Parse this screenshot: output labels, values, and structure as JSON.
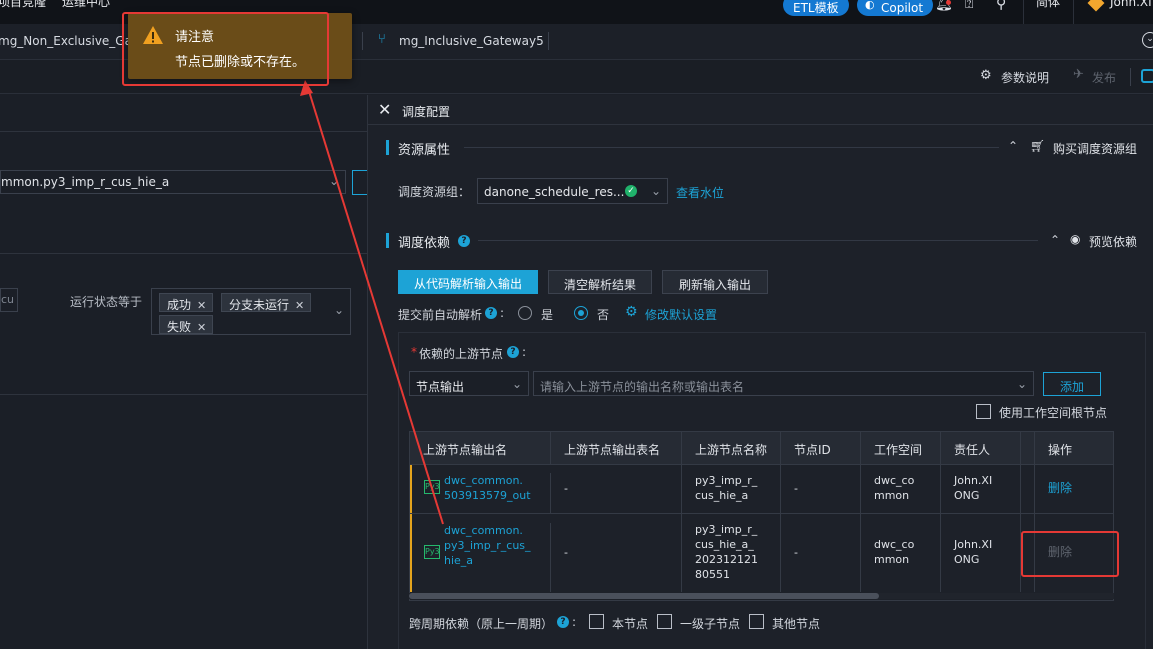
{
  "topbar": {
    "menu_items": [
      "项目竞隆",
      "运维中心"
    ],
    "etl_label": "ETL模板",
    "copilot_label": "Copilot",
    "lang_label": "简体",
    "user_name": "John.XI"
  },
  "tabs": [
    {
      "label": "mg_Non_Exclusive_Gateway"
    },
    {
      "label": "mg_Inclusive_Gateway5"
    }
  ],
  "toolbar": {
    "params_label": "参数说明",
    "publish_label": "发布"
  },
  "left_panel": {
    "node_select_value": "mmon.py3_imp_r_cus_hie_a",
    "cu_input_value": "cu",
    "status_label": "运行状态等于",
    "status_tags": [
      "成功",
      "分支未运行",
      "失败"
    ]
  },
  "right_panel": {
    "title": "调度配置",
    "resource": {
      "section_title": "资源属性",
      "buy_label": "购买调度资源组",
      "group_label": "调度资源组：",
      "group_value": "danone_schedule_res...",
      "water_link": "查看水位"
    },
    "dependency": {
      "section_title": "调度依赖",
      "preview_label": "预览依赖",
      "btn_parse": "从代码解析输入输出",
      "btn_clear": "清空解析结果",
      "btn_refresh": "刷新输入输出",
      "auto_parse_label": "提交前自动解析",
      "radio_yes": "是",
      "radio_no": "否",
      "modify_default": "修改默认设置",
      "upstream_label": "依赖的上游节点",
      "upstream_type": "节点输出",
      "upstream_placeholder": "请输入上游节点的输出名称或输出表名",
      "add_btn": "添加",
      "use_root_label": "使用工作空间根节点",
      "table": {
        "headers": [
          "上游节点输出名",
          "上游节点输出表名",
          "上游节点名称",
          "节点ID",
          "工作空间",
          "责任人",
          "",
          "操作"
        ],
        "rows": [
          {
            "output_name_1": "dwc_common.",
            "output_name_2": "503913579_out",
            "table_name": "-",
            "node_name_1": "py3_imp_r_",
            "node_name_2": "cus_hie_a",
            "node_id": "-",
            "workspace_1": "dwc_co",
            "workspace_2": "mmon",
            "owner_1": "John.XI",
            "owner_2": "ONG",
            "action": "删除"
          },
          {
            "output_name_1": "dwc_common.",
            "output_name_2": "py3_imp_r_cus_",
            "output_name_3": "hie_a",
            "table_name": "-",
            "node_name_1": "py3_imp_r_",
            "node_name_2": "cus_hie_a_",
            "node_name_3": "202312121",
            "node_name_4": "80551",
            "node_id": "-",
            "workspace_1": "dwc_co",
            "workspace_2": "mmon",
            "owner_1": "John.XI",
            "owner_2": "ONG",
            "action": "删除"
          }
        ]
      },
      "cross_cycle_label": "跨周期依赖（原上一周期）",
      "cross_options": [
        "本节点",
        "一级子节点",
        "其他节点"
      ]
    }
  },
  "toast": {
    "title": "请注意",
    "message": "节点已删除或不存在。"
  },
  "colors": {
    "accent": "#1da3d6",
    "warning_bg": "#6a4c18",
    "annotation_red": "#e53935",
    "row_accent": "#e5a41d",
    "success": "#20b26b"
  }
}
